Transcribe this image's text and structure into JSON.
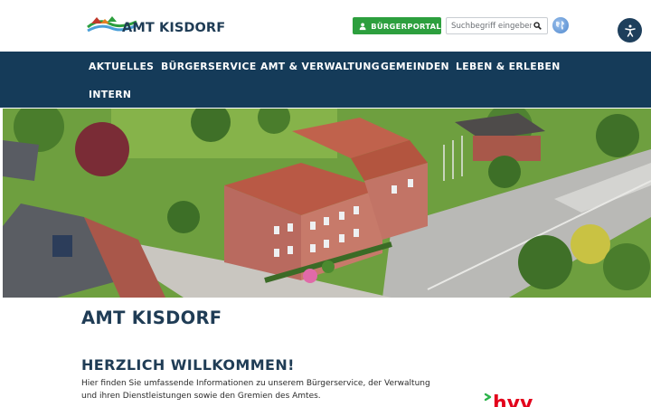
{
  "header": {
    "logo_text": "AMT KISDORF",
    "portal_button_label": "BÜRGERPORTAL",
    "search_placeholder": "Suchbegriff eingeben ..."
  },
  "nav": {
    "items": [
      {
        "label": "AKTUELLES"
      },
      {
        "label": "BÜRGERSERVICE"
      },
      {
        "label": "AMT & VERWALTUNG"
      },
      {
        "label": "GEMEINDEN"
      },
      {
        "label": "LEBEN & ERLEBEN"
      },
      {
        "label": "INTERN"
      }
    ]
  },
  "content": {
    "site_title": "AMT KISDORF",
    "welcome_heading": "HERZLICH WILLKOMMEN!",
    "welcome_text": "Hier finden Sie umfassende Informationen zu unserem Bürgerservice, der Verwaltung und ihren Dienstleistungen sowie den Gremien des Amtes."
  },
  "partner_logo_text": "hvv",
  "colors": {
    "brand_dark_blue": "#153b59",
    "portal_green": "#2d9f3e",
    "heading_blue": "#1f3c55",
    "accessibility_button": "#1e3f5c",
    "partner_green": "#2bb34a",
    "partner_red": "#e3001b"
  },
  "icons": {
    "portal_button": "user-icon",
    "search": "search-icon",
    "language": "globe-icon",
    "accessibility": "accessibility-icon"
  }
}
